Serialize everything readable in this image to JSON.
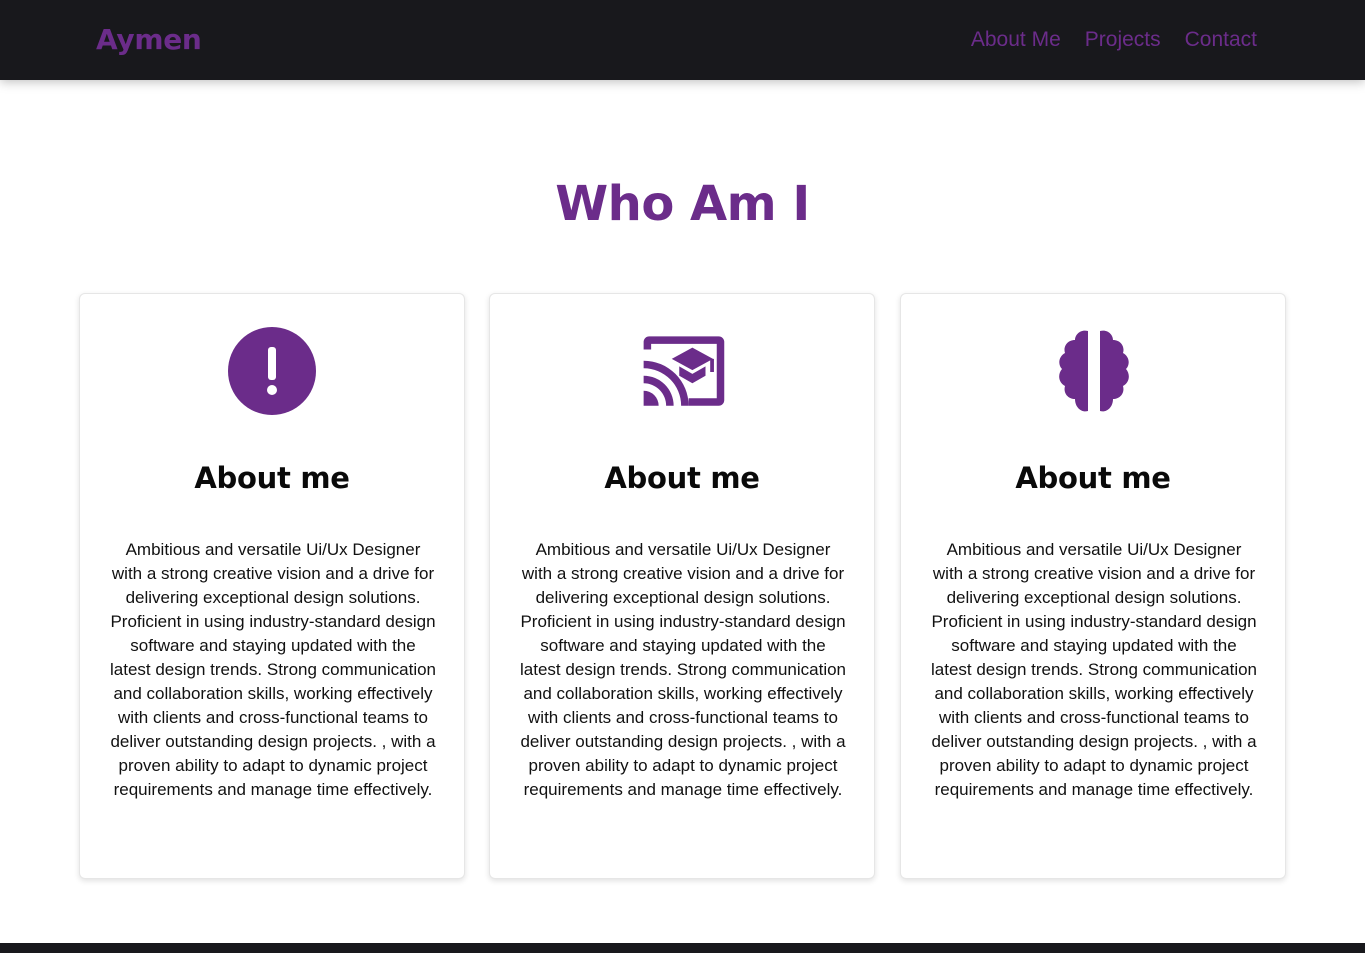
{
  "navbar": {
    "brand": "Aymen",
    "links": [
      "About Me",
      "Projects",
      "Contact"
    ]
  },
  "section": {
    "title": "Who Am I"
  },
  "cards": [
    {
      "icon": "exclamation-circle-icon",
      "title": "About me",
      "text": "Ambitious and versatile Ui/Ux Designer with a strong creative vision and a drive for delivering exceptional design solutions. Proficient in using industry-standard design software and staying updated with the latest design trends. Strong communication and collaboration skills, working effectively with clients and cross-functional teams to deliver outstanding design projects. , with a proven ability to adapt to dynamic project requirements and manage time effectively."
    },
    {
      "icon": "cast-for-education-icon",
      "title": "About me",
      "text": "Ambitious and versatile Ui/Ux Designer with a strong creative vision and a drive for delivering exceptional design solutions. Proficient in using industry-standard design software and staying updated with the latest design trends. Strong communication and collaboration skills, working effectively with clients and cross-functional teams to deliver outstanding design projects. , with a proven ability to adapt to dynamic project requirements and manage time effectively."
    },
    {
      "icon": "brain-icon",
      "title": "About me",
      "text": "Ambitious and versatile Ui/Ux Designer with a strong creative vision and a drive for delivering exceptional design solutions. Proficient in using industry-standard design software and staying updated with the latest design trends. Strong communication and collaboration skills, working effectively with clients and cross-functional teams to deliver outstanding design projects. , with a proven ability to adapt to dynamic project requirements and manage time effectively."
    }
  ],
  "colors": {
    "accent": "#6b2c8a",
    "navbar_bg": "#18181c",
    "text": "#111111"
  }
}
